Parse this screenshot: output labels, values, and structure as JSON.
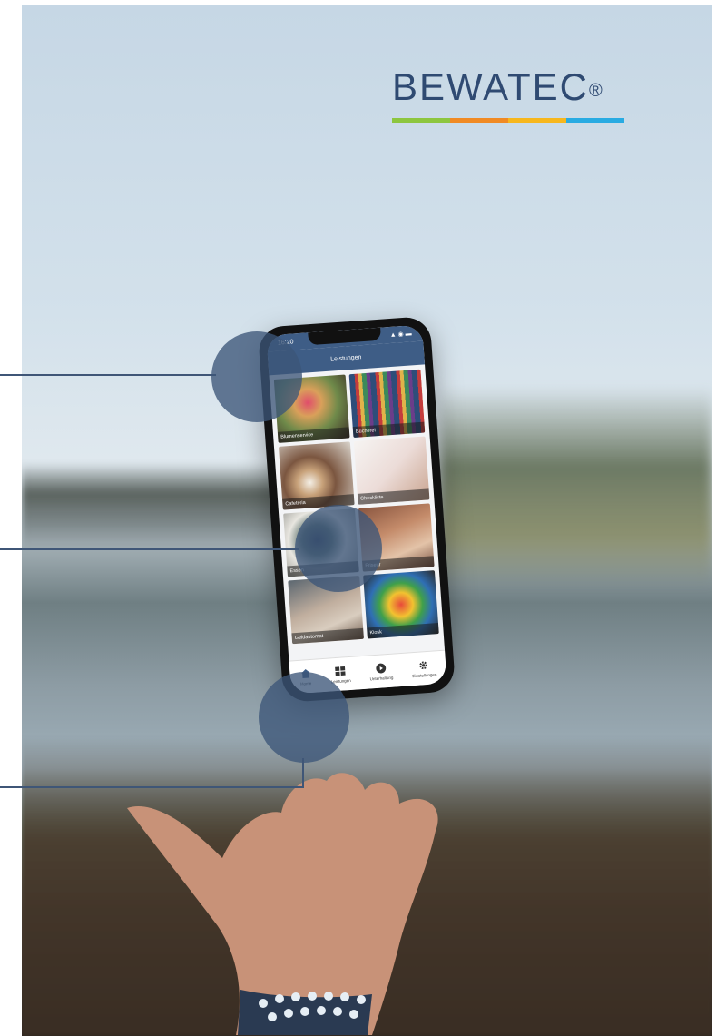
{
  "brand": {
    "name": "BEWATEC",
    "registered_mark": "®",
    "stripe_colors": [
      "#8dc63f",
      "#f08a24",
      "#f7b71d",
      "#29abe2"
    ],
    "text_color": "#2f4a72"
  },
  "phone": {
    "time": "16:20",
    "status_icons": "▲ ◉ ▬",
    "screen_title": "Leistungen",
    "tiles": [
      {
        "label": "Blumenservice"
      },
      {
        "label": "Bücherei"
      },
      {
        "label": "Cafeteria"
      },
      {
        "label": "Checkliste"
      },
      {
        "label": "Essen"
      },
      {
        "label": "Friseur"
      },
      {
        "label": "Geldautomat"
      },
      {
        "label": "Kiosk"
      }
    ],
    "tabs": [
      {
        "label": "Home",
        "icon": "home-icon"
      },
      {
        "label": "Leistungen",
        "icon": "grid-icon"
      },
      {
        "label": "Unterhaltung",
        "icon": "play-icon"
      },
      {
        "label": "Einstellungen",
        "icon": "gear-icon"
      }
    ],
    "accent_color": "#3e5d86"
  },
  "callout_color": "#3c5678"
}
